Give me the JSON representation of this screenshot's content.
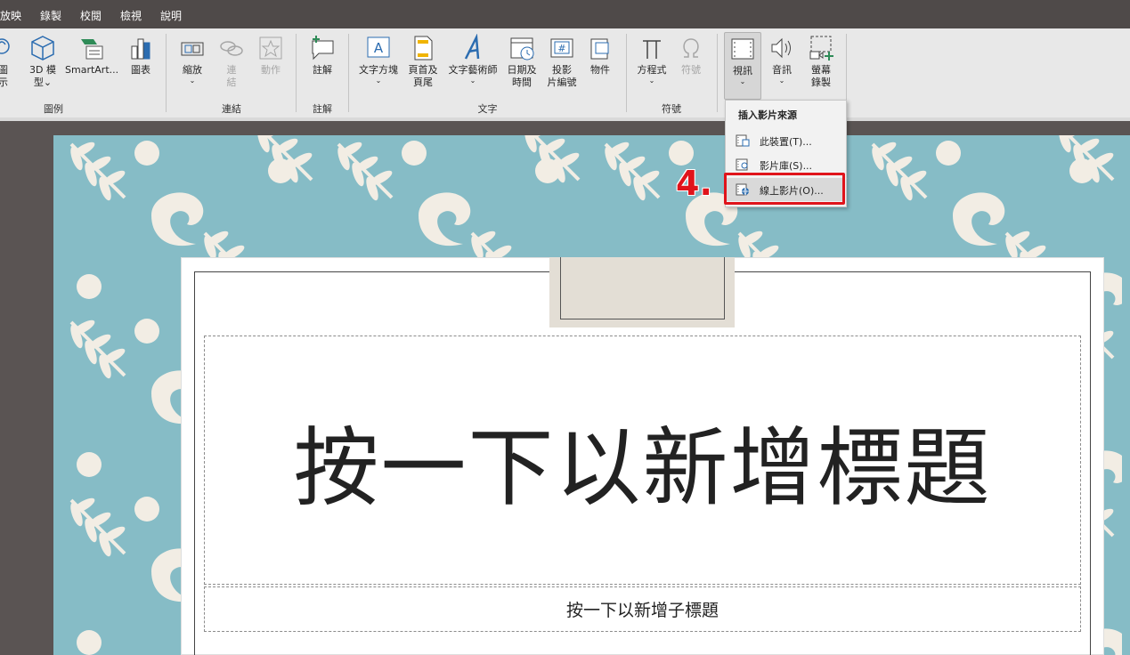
{
  "menubar": {
    "items": [
      "放映",
      "錄製",
      "校閱",
      "檢視",
      "說明"
    ]
  },
  "ribbon": {
    "groups": {
      "illustrations": "圖例",
      "links": "連結",
      "comments": "註解",
      "text": "文字",
      "symbols": "符號"
    },
    "buttons": {
      "icons_line1": "圖",
      "icons_line2": "示",
      "models_line1": "3D 模",
      "models_line2": "型",
      "smartart": "SmartArt...",
      "chart": "圖表",
      "zoom": "縮放",
      "link_line1": "連",
      "link_line2": "結",
      "action": "動作",
      "comment": "註解",
      "textbox": "文字方塊",
      "header_line1": "頁首及",
      "header_line2": "頁尾",
      "wordart": "文字藝術師",
      "datetime_line1": "日期及",
      "datetime_line2": "時間",
      "slidenum_line1": "投影",
      "slidenum_line2": "片編號",
      "object": "物件",
      "equation": "方程式",
      "symbol": "符號",
      "video": "視訊",
      "audio": "音訊",
      "screenrec_line1": "螢幕",
      "screenrec_line2": "錄製"
    }
  },
  "dropdown": {
    "header": "插入影片來源",
    "items": [
      {
        "label": "此裝置(T)..."
      },
      {
        "label": "影片庫(S)..."
      },
      {
        "label": "線上影片(O)..."
      }
    ]
  },
  "annotation": {
    "step": "4."
  },
  "slide": {
    "title": "按一下以新增標題",
    "subtitle": "按一下以新增子標題"
  },
  "colors": {
    "slide_background": "#86bcc6",
    "pattern": "#f2ede4",
    "highlight": "#e0141b",
    "ribbon": "#e8e8e8",
    "menubar": "#4f4a49"
  }
}
